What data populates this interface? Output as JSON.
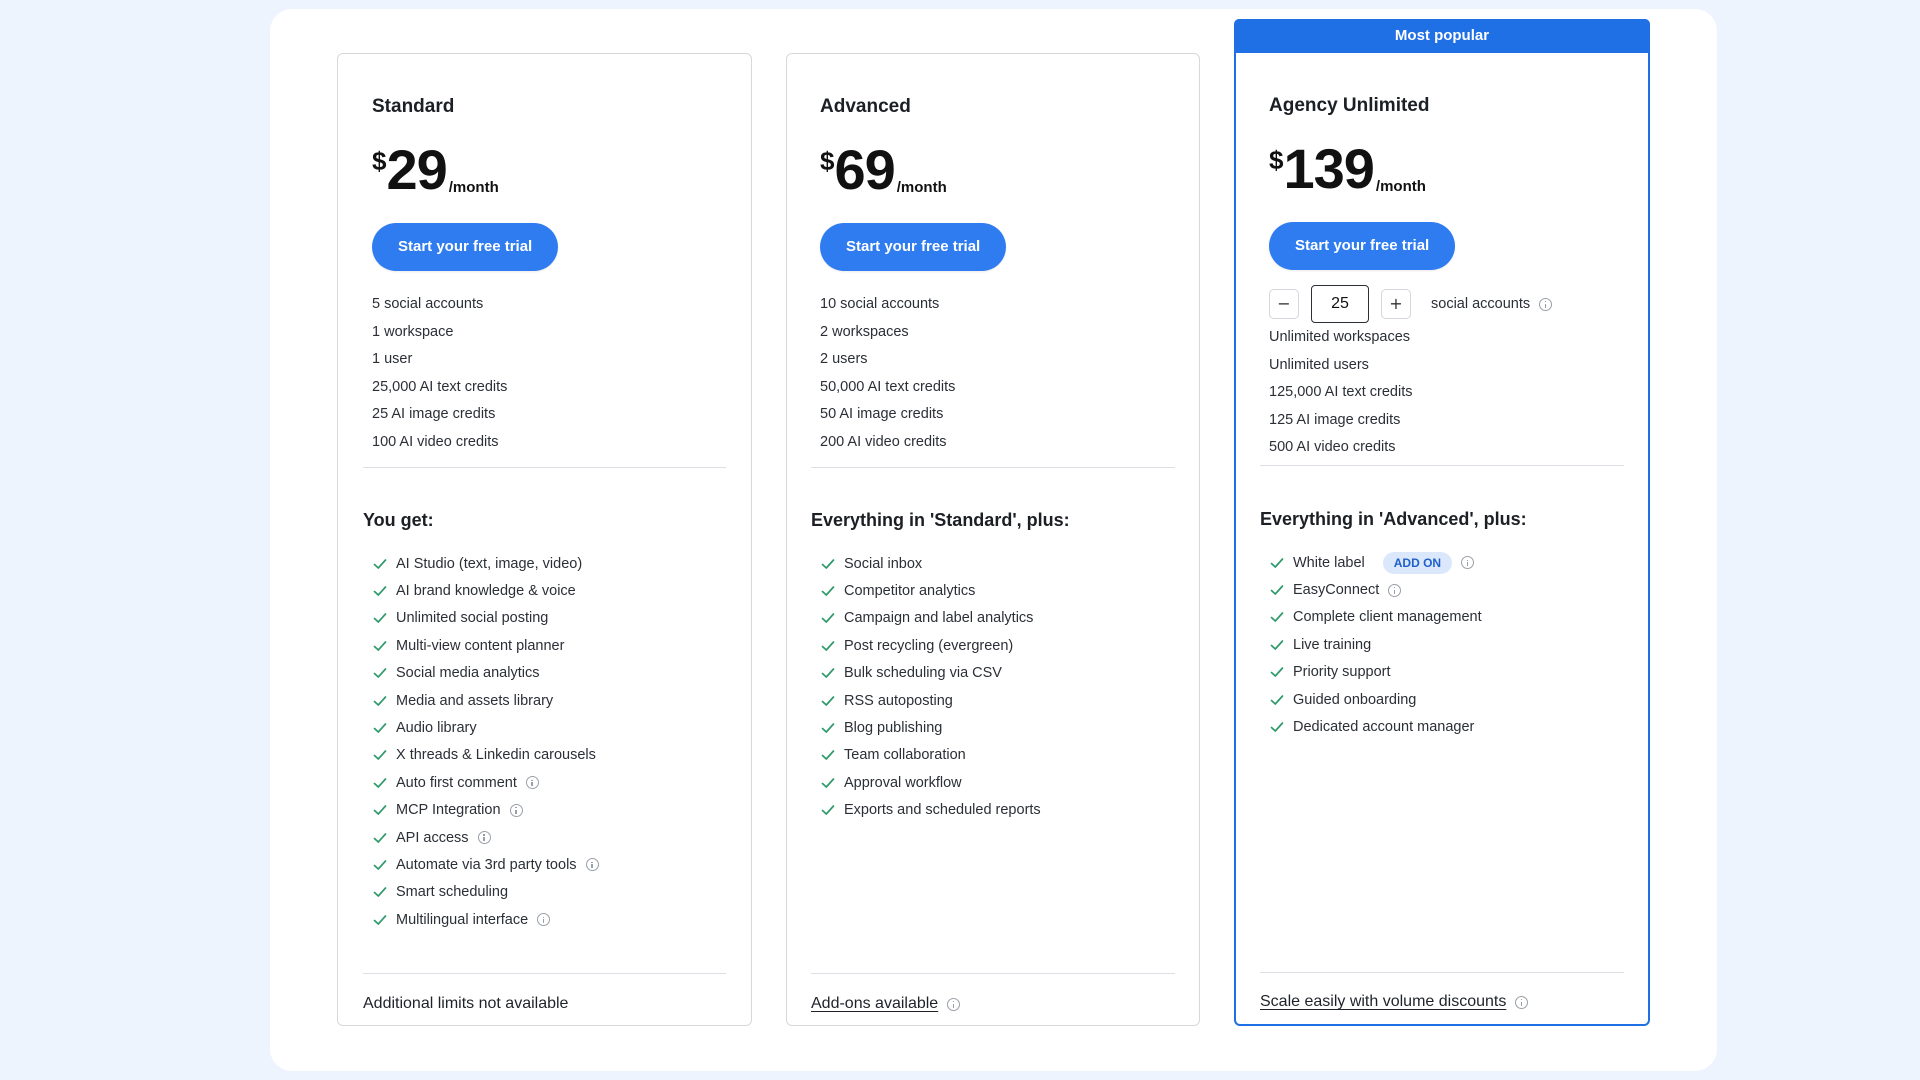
{
  "plans": [
    {
      "name": "Standard",
      "currency": "$",
      "price": "29",
      "period": "/month",
      "cta": "Start your free trial",
      "limits": [
        "5 social accounts",
        "1 workspace",
        "1 user",
        "25,000 AI text credits",
        "25 AI image credits",
        "100 AI video credits"
      ],
      "features_title": "You get:",
      "features": [
        {
          "label": "AI Studio (text, image, video)",
          "info": false
        },
        {
          "label": "AI brand knowledge & voice",
          "info": false
        },
        {
          "label": "Unlimited social posting",
          "info": false
        },
        {
          "label": "Multi-view content planner",
          "info": false
        },
        {
          "label": "Social media analytics",
          "info": false
        },
        {
          "label": "Media and assets library",
          "info": false
        },
        {
          "label": "Audio library",
          "info": false
        },
        {
          "label": "X threads & Linkedin carousels",
          "info": false
        },
        {
          "label": "Auto first comment",
          "info": true
        },
        {
          "label": "MCP Integration",
          "info": true
        },
        {
          "label": "API access",
          "info": true
        },
        {
          "label": "Automate via 3rd party tools",
          "info": true
        },
        {
          "label": "Smart scheduling",
          "info": false
        },
        {
          "label": "Multilingual interface",
          "info": true
        }
      ],
      "footer": "Additional limits not available"
    },
    {
      "name": "Advanced",
      "currency": "$",
      "price": "69",
      "period": "/month",
      "cta": "Start your free trial",
      "limits": [
        "10 social accounts",
        "2 workspaces",
        "2 users",
        "50,000 AI text credits",
        "50 AI image credits",
        "200 AI video credits"
      ],
      "features_title": "Everything in 'Standard', plus:",
      "features": [
        {
          "label": "Social inbox",
          "info": false
        },
        {
          "label": "Competitor analytics",
          "info": false
        },
        {
          "label": "Campaign and label analytics",
          "info": false
        },
        {
          "label": "Post recycling (evergreen)",
          "info": false
        },
        {
          "label": "Bulk scheduling via CSV",
          "info": false
        },
        {
          "label": "RSS autoposting",
          "info": false
        },
        {
          "label": "Blog publishing",
          "info": false
        },
        {
          "label": "Team collaboration",
          "info": false
        },
        {
          "label": "Approval workflow",
          "info": false
        },
        {
          "label": "Exports and scheduled reports",
          "info": false
        }
      ],
      "footer": "Add-ons available"
    },
    {
      "badge": "Most popular",
      "name": "Agency Unlimited",
      "currency": "$",
      "price": "139",
      "period": "/month",
      "cta": "Start your free trial",
      "stepper": {
        "minus": "−",
        "value": "25",
        "plus": "+",
        "label": "social accounts"
      },
      "limits": [
        "Unlimited workspaces",
        "Unlimited users",
        "125,000 AI text credits",
        "125 AI image credits",
        "500 AI video credits"
      ],
      "features_title": "Everything in 'Advanced', plus:",
      "features": [
        {
          "label": "White label",
          "info": true,
          "badge": "ADD ON"
        },
        {
          "label": "EasyConnect",
          "info": true
        },
        {
          "label": "Complete client management",
          "info": false
        },
        {
          "label": "Live training",
          "info": false
        },
        {
          "label": "Priority support",
          "info": false
        },
        {
          "label": "Guided onboarding",
          "info": false
        },
        {
          "label": "Dedicated account manager",
          "info": false
        }
      ],
      "footer": "Scale easily with volume discounts"
    }
  ],
  "colors": {
    "accent": "#2f7cf0",
    "popular_border": "#1f6fe5",
    "check": "#2e9a6a",
    "page_bg": "#eef4fd"
  }
}
